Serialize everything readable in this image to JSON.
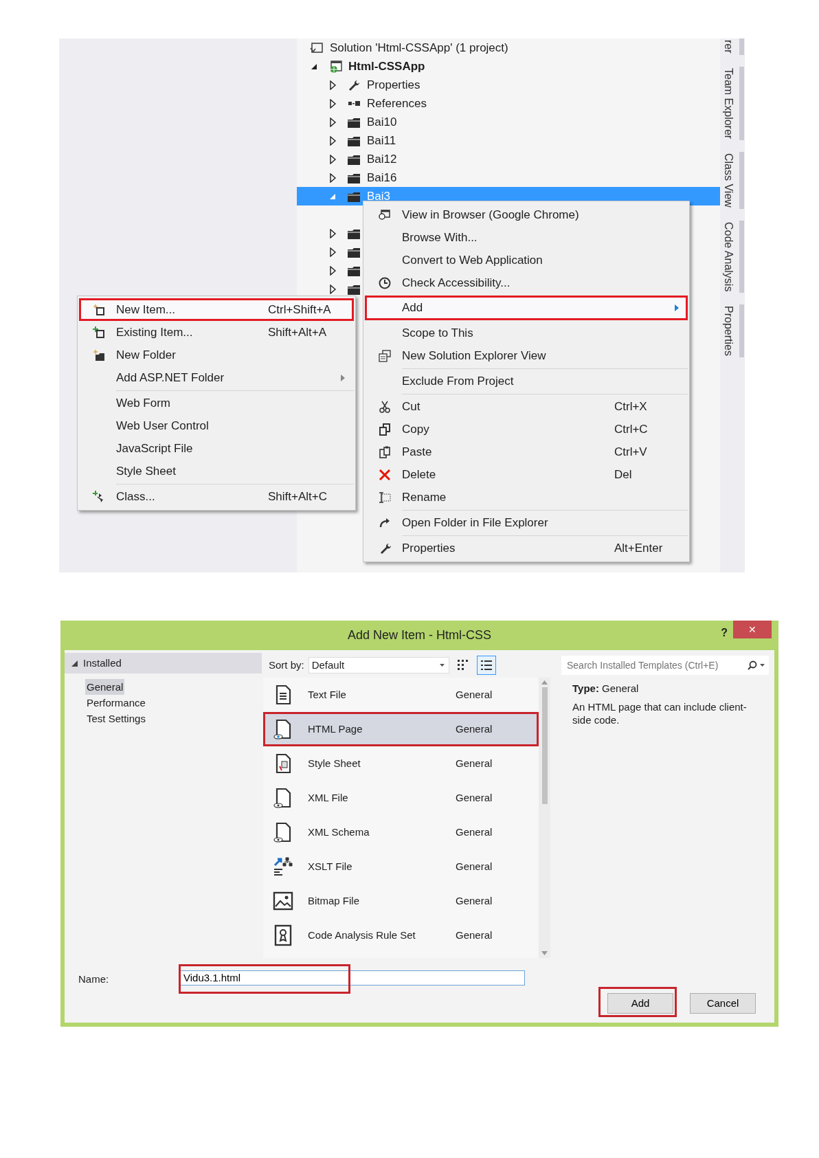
{
  "solution_explorer": {
    "tree": [
      {
        "kind": "solution",
        "label": "Solution 'Html-CSSApp' (1 project)",
        "selected": false,
        "children": [
          {
            "kind": "project",
            "label": "Html-CSSApp",
            "expanded": true,
            "selected": false,
            "children": [
              {
                "kind": "properties",
                "label": "Properties",
                "expanded": false,
                "selected": false
              },
              {
                "kind": "references",
                "label": "References",
                "expanded": false,
                "selected": false
              },
              {
                "kind": "folder",
                "label": "Bai10",
                "expanded": false,
                "selected": false
              },
              {
                "kind": "folder",
                "label": "Bai11",
                "expanded": false,
                "selected": false
              },
              {
                "kind": "folder",
                "label": "Bai12",
                "expanded": false,
                "selected": false
              },
              {
                "kind": "folder",
                "label": "Bai16",
                "expanded": false,
                "selected": false
              },
              {
                "kind": "folder",
                "label": "Bai3",
                "expanded": true,
                "selected": true
              },
              {
                "kind": "folder",
                "expanded": false,
                "selected": false
              },
              {
                "kind": "folder",
                "expanded": false,
                "selected": false
              },
              {
                "kind": "folder",
                "expanded": false,
                "selected": false
              },
              {
                "kind": "folder",
                "expanded": false,
                "selected": false
              }
            ]
          }
        ]
      }
    ],
    "side_tabs": [
      "rer",
      "Team Explorer",
      "Class View",
      "Code Analysis",
      "Properties"
    ]
  },
  "context_menu": {
    "items": [
      {
        "kind": "view",
        "label": "View in Browser (Google Chrome)",
        "selected": false
      },
      {
        "kind": "plain",
        "label": "Browse With...",
        "selected": false
      },
      {
        "kind": "plain",
        "label": "Convert to Web Application",
        "selected": false
      },
      {
        "kind": "accessibility",
        "label": "Check Accessibility...",
        "selected": false
      },
      {
        "kind": "submenu",
        "label": "Add",
        "selected": true
      },
      {
        "kind": "plain",
        "label": "Scope to This",
        "selected": false
      },
      {
        "kind": "solution-view",
        "label": "New Solution Explorer View",
        "selected": false
      },
      {
        "kind": "separator"
      },
      {
        "kind": "plain",
        "label": "Exclude From Project",
        "selected": false
      },
      {
        "kind": "separator"
      },
      {
        "kind": "cut",
        "label": "Cut",
        "shortcut": "Ctrl+X",
        "selected": false
      },
      {
        "kind": "copy",
        "label": "Copy",
        "shortcut": "Ctrl+C",
        "selected": false
      },
      {
        "kind": "paste",
        "label": "Paste",
        "shortcut": "Ctrl+V",
        "selected": false
      },
      {
        "kind": "delete",
        "label": "Delete",
        "shortcut": "Del",
        "selected": false
      },
      {
        "kind": "rename",
        "label": "Rename",
        "selected": false
      },
      {
        "kind": "separator"
      },
      {
        "kind": "open-folder",
        "label": "Open Folder in File Explorer",
        "selected": false
      },
      {
        "kind": "separator"
      },
      {
        "kind": "properties",
        "label": "Properties",
        "shortcut": "Alt+Enter",
        "selected": false
      }
    ]
  },
  "add_submenu": {
    "items": [
      {
        "kind": "new-item",
        "label": "New Item...",
        "shortcut": "Ctrl+Shift+A",
        "selected": true
      },
      {
        "kind": "existing-item",
        "label": "Existing Item...",
        "shortcut": "Shift+Alt+A",
        "selected": false
      },
      {
        "kind": "new-folder",
        "label": "New Folder",
        "selected": false
      },
      {
        "kind": "submenu",
        "label": "Add ASP.NET Folder",
        "selected": false
      },
      {
        "kind": "separator"
      },
      {
        "kind": "plain",
        "label": "Web Form",
        "selected": false
      },
      {
        "kind": "plain",
        "label": "Web User Control",
        "selected": false
      },
      {
        "kind": "plain",
        "label": "JavaScript File",
        "selected": false
      },
      {
        "kind": "plain",
        "label": "Style Sheet",
        "selected": false
      },
      {
        "kind": "separator"
      },
      {
        "kind": "class",
        "label": "Class...",
        "shortcut": "Shift+Alt+C",
        "selected": false
      }
    ]
  },
  "dialog": {
    "title": "Add New Item - Html-CSS",
    "help": "?",
    "close": "✕",
    "categories": {
      "header": "Installed",
      "expanded": true,
      "items": [
        {
          "label": "General",
          "selected": true
        },
        {
          "label": "Performance",
          "selected": false
        },
        {
          "label": "Test Settings",
          "selected": false
        }
      ]
    },
    "sort": {
      "label": "Sort by:",
      "value": "Default"
    },
    "view_modes": [
      {
        "kind": "grid",
        "selected": false
      },
      {
        "kind": "list",
        "selected": true
      }
    ],
    "templates": [
      {
        "kind": "text",
        "name": "Text File",
        "category": "General",
        "selected": false
      },
      {
        "kind": "html",
        "name": "HTML Page",
        "category": "General",
        "selected": true
      },
      {
        "kind": "css",
        "name": "Style Sheet",
        "category": "General",
        "selected": false
      },
      {
        "kind": "xml",
        "name": "XML File",
        "category": "General",
        "selected": false
      },
      {
        "kind": "xml",
        "name": "XML Schema",
        "category": "General",
        "selected": false
      },
      {
        "kind": "xslt",
        "name": "XSLT File",
        "category": "General",
        "selected": false
      },
      {
        "kind": "bitmap",
        "name": "Bitmap File",
        "category": "General",
        "selected": false
      },
      {
        "kind": "ruleset",
        "name": "Code Analysis Rule Set",
        "category": "General",
        "selected": false
      }
    ],
    "search": {
      "placeholder": "Search Installed Templates (Ctrl+E)"
    },
    "details": {
      "type_label": "Type:",
      "type_value": "General",
      "description": "An HTML page that can include client-side code."
    },
    "name_field": {
      "label": "Name:",
      "value": "Vidu3.1.html",
      "highlighted": true
    },
    "buttons": [
      {
        "label": "Add",
        "highlighted": true
      },
      {
        "label": "Cancel",
        "highlighted": false
      }
    ]
  }
}
